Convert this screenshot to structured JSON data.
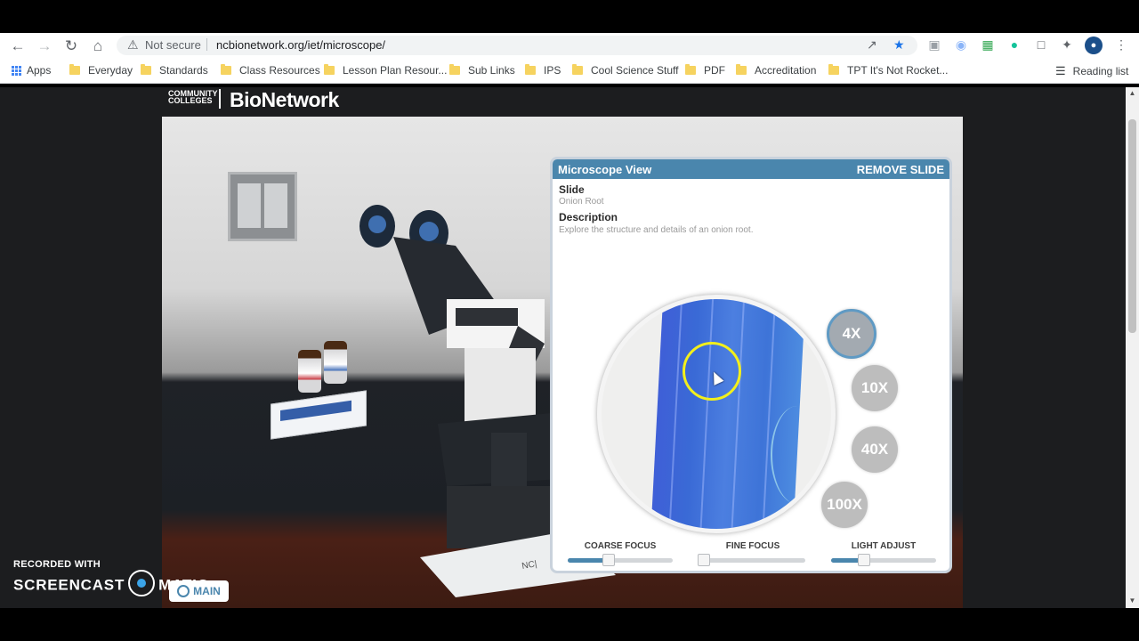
{
  "browser": {
    "security_label": "Not secure",
    "url": "ncbionetwork.org/iet/microscope/",
    "bookmarks": [
      {
        "label": "Apps"
      },
      {
        "label": "Everyday"
      },
      {
        "label": "Standards"
      },
      {
        "label": "Class Resources"
      },
      {
        "label": "Lesson Plan Resour..."
      },
      {
        "label": "Sub Links"
      },
      {
        "label": "IPS"
      },
      {
        "label": "Cool Science Stuff"
      },
      {
        "label": "PDF"
      },
      {
        "label": "Accreditation"
      },
      {
        "label": "TPT It's Not Rocket..."
      }
    ],
    "reading_list": "Reading list"
  },
  "site": {
    "logo_left": "COMMUNITY COLLEGES",
    "logo_right": "BioNetwork"
  },
  "panel": {
    "title": "Microscope View",
    "remove_label": "REMOVE SLIDE",
    "slide_label": "Slide",
    "slide_value": "Onion Root",
    "description_label": "Description",
    "description_value": "Explore the structure and details of an onion root.",
    "magnifications": [
      {
        "label": "4X",
        "active": true
      },
      {
        "label": "10X",
        "active": false
      },
      {
        "label": "40X",
        "active": false
      },
      {
        "label": "100X",
        "active": false
      }
    ],
    "sliders": [
      {
        "label": "COARSE FOCUS",
        "level": 0.36
      },
      {
        "label": "FINE FOCUS",
        "level": 0.0
      },
      {
        "label": "LIGHT ADJUST",
        "level": 0.28
      }
    ]
  },
  "overlay": {
    "recorded_with": "RECORDED WITH",
    "screencast_left": "SCREENCAST",
    "screencast_right": "MATIC",
    "main_button": "MAIN"
  },
  "colors": {
    "accent": "#4a86ad",
    "active_ring": "#5f9ac4",
    "cursor_ring": "#f2ef1c"
  }
}
